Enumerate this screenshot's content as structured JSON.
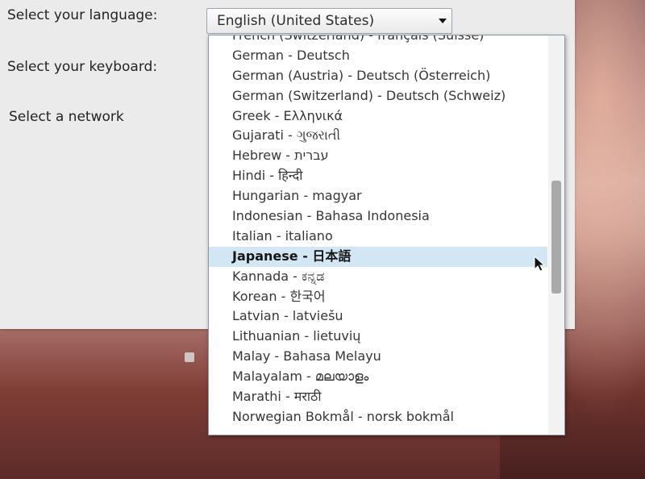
{
  "labels": {
    "language": "Select your language:",
    "keyboard": "Select your keyboard:",
    "network": "Select a network"
  },
  "language_select": {
    "value": "English (United States)",
    "arrow_icon": "triangle-down-icon"
  },
  "language_list": {
    "selected_index": 10,
    "items": [
      "French (Switzerland) - français (Suisse)",
      "German - Deutsch",
      "German (Austria) - Deutsch (Österreich)",
      "German (Switzerland) - Deutsch (Schweiz)",
      "Greek - Ελληνικά",
      "Gujarati - ગુજરાતી",
      "Hebrew - עברית",
      "Hindi - हिन्दी",
      "Hungarian - magyar",
      "Indonesian - Bahasa Indonesia",
      "Italian - italiano",
      "Japanese - 日本語",
      "Kannada - ಕನ್ನಡ",
      "Korean - 한국어",
      "Latvian - latviešu",
      "Lithuanian - lietuvių",
      "Malay - Bahasa Melayu",
      "Malayalam - മലയാളം",
      "Marathi - मराठी",
      "Norwegian Bokmål - norsk bokmål"
    ]
  },
  "colors": {
    "selection": "#d3e6f4",
    "panel": "#ebebeb"
  }
}
